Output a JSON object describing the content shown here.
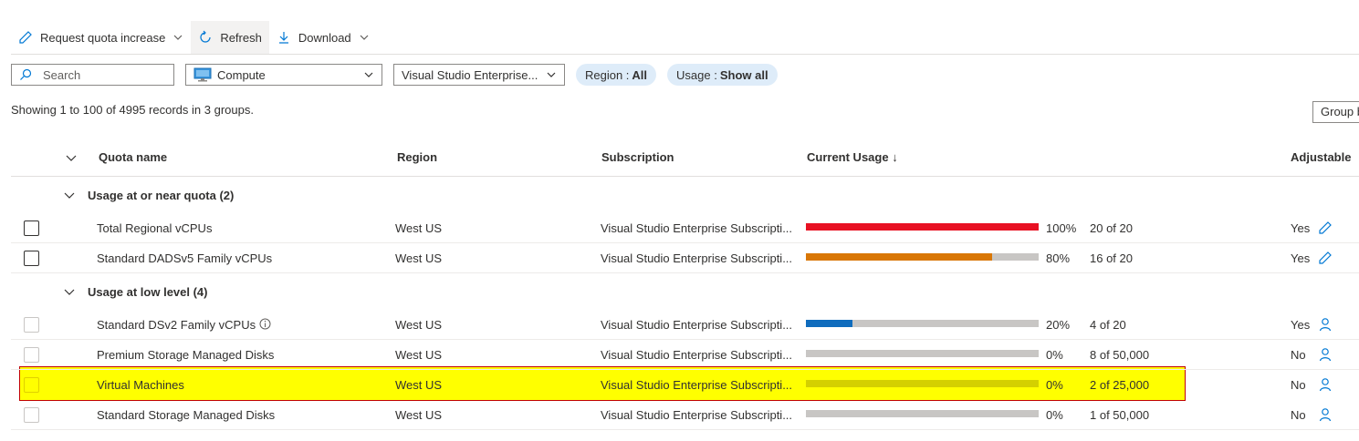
{
  "toolbar": {
    "request_label": "Request quota increase",
    "refresh_label": "Refresh",
    "download_label": "Download"
  },
  "filters": {
    "search_placeholder": "Search",
    "category_value": "Compute",
    "subscription_value": "Visual Studio Enterprise...",
    "region_label": "Region :",
    "region_value": "All",
    "usage_label": "Usage :",
    "usage_value": "Show all"
  },
  "summary": {
    "records_text": "Showing 1 to 100 of 4995 records in 3 groups.",
    "group_by_label": "Group b"
  },
  "table": {
    "headers": {
      "quota_name": "Quota name",
      "region": "Region",
      "subscription": "Subscription",
      "current_usage": "Current Usage ↓",
      "adjustable": "Adjustable"
    },
    "groups": [
      {
        "label": "Usage at or near quota (2)"
      },
      {
        "label": "Usage at low level (4)"
      }
    ],
    "rows": [
      {
        "name": "Total Regional vCPUs",
        "region": "West US",
        "subscription": "Visual Studio Enterprise Subscripti...",
        "usage_fraction": 1.0,
        "usage_color": "#e81123",
        "percent": "100%",
        "of": "20 of 20",
        "adjustable": "Yes",
        "adjust_icon": "pencil-icon"
      },
      {
        "name": "Standard DADSv5 Family vCPUs",
        "region": "West US",
        "subscription": "Visual Studio Enterprise Subscripti...",
        "usage_fraction": 0.8,
        "usage_color": "#d97706",
        "percent": "80%",
        "of": "16 of 20",
        "adjustable": "Yes",
        "adjust_icon": "pencil-icon"
      },
      {
        "name": "Standard DSv2 Family vCPUs",
        "region": "West US",
        "subscription": "Visual Studio Enterprise Subscripti...",
        "usage_fraction": 0.2,
        "usage_color": "#0f6cbd",
        "percent": "20%",
        "of": "4 of 20",
        "adjustable": "Yes",
        "adjust_icon": "person-icon"
      },
      {
        "name": "Premium Storage Managed Disks",
        "region": "West US",
        "subscription": "Visual Studio Enterprise Subscripti...",
        "usage_fraction": 0.0,
        "usage_color": "#c8c6c4",
        "percent": "0%",
        "of": "8 of 50,000",
        "adjustable": "No",
        "adjust_icon": "person-icon"
      },
      {
        "name": "Virtual Machines",
        "region": "West US",
        "subscription": "Visual Studio Enterprise Subscripti...",
        "usage_fraction": 0.0,
        "usage_color": "#c8c6c4",
        "percent": "0%",
        "of": "2 of 25,000",
        "adjustable": "No",
        "adjust_icon": "person-icon"
      },
      {
        "name": "Standard Storage Managed Disks",
        "region": "West US",
        "subscription": "Visual Studio Enterprise Subscripti...",
        "usage_fraction": 0.0,
        "usage_color": "#c8c6c4",
        "percent": "0%",
        "of": "1 of 50,000",
        "adjustable": "No",
        "adjust_icon": "person-icon"
      }
    ]
  },
  "colors": {
    "accent": "#0078d4",
    "highlight": "#ffff00",
    "highlight_border": "#c00000"
  }
}
